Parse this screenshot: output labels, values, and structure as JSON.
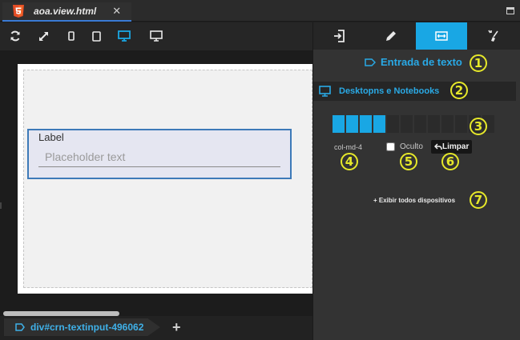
{
  "tab": {
    "title": "aoa.view.html",
    "close": "✕"
  },
  "toolbar": {
    "buttons": [
      "refresh-icon",
      "expand-icon",
      "phone-icon",
      "tablet-icon",
      "desktop-icon",
      "wide-screen-icon"
    ],
    "active": "desktop-icon",
    "accent": "#19a7e4"
  },
  "canvas": {
    "component": {
      "label": "Label",
      "placeholder": "Placeholder text"
    }
  },
  "breadcrumb": {
    "text": "div#crn-textinput-496062",
    "add": "+"
  },
  "panel": {
    "tabs": [
      "login-icon",
      "pencil-icon",
      "resize-horizontal-icon",
      "brush-icon"
    ],
    "active_tab": "resize-horizontal-icon",
    "component_title": "Entrada de texto",
    "section_title": "Desktopns e Notebooks",
    "grid": {
      "total": 12,
      "filled": 4
    },
    "column_class": "col-md-4",
    "hidden_label": "Oculto",
    "clear_label": "Limpar",
    "show_all": "+ Exibir todos dispositivos"
  },
  "annotations": [
    "1",
    "2",
    "3",
    "4",
    "5",
    "6",
    "7"
  ]
}
